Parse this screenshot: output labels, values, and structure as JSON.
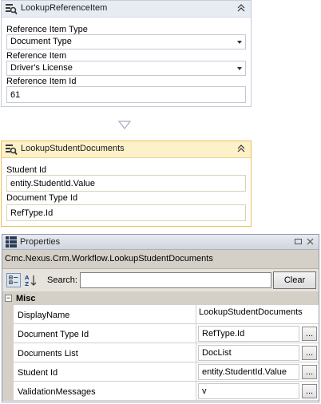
{
  "activity1": {
    "title": "LookupReferenceItem",
    "fields": [
      {
        "label": "Reference Item Type",
        "value": "Document Type"
      },
      {
        "label": "Reference Item",
        "value": "Driver's License"
      },
      {
        "label": "Reference Item Id",
        "value": "61"
      }
    ]
  },
  "activity2": {
    "title": "LookupStudentDocuments",
    "fields": [
      {
        "label": "Student Id",
        "value": "entity.StudentId.Value"
      },
      {
        "label": "Document Type Id",
        "value": "RefType.Id"
      }
    ]
  },
  "properties": {
    "title": "Properties",
    "class_name": "Cmc.Nexus.Crm.Workflow.LookupStudentDocuments",
    "search_label": "Search:",
    "search_value": "",
    "clear_label": "Clear",
    "category": "Misc",
    "rows": [
      {
        "name": "DisplayName",
        "value": "LookupStudentDocuments"
      },
      {
        "name": "Document Type Id",
        "value": "RefType.Id"
      },
      {
        "name": "Documents List",
        "value": "DocList"
      },
      {
        "name": "Student Id",
        "value": "entity.StudentId.Value"
      },
      {
        "name": "ValidationMessages",
        "value": "v"
      }
    ],
    "ellipsis": "..."
  },
  "colors": {
    "selected_header": "#fdf1c9",
    "selected_border": "#e9c15a",
    "header": "#e7ecf3"
  }
}
